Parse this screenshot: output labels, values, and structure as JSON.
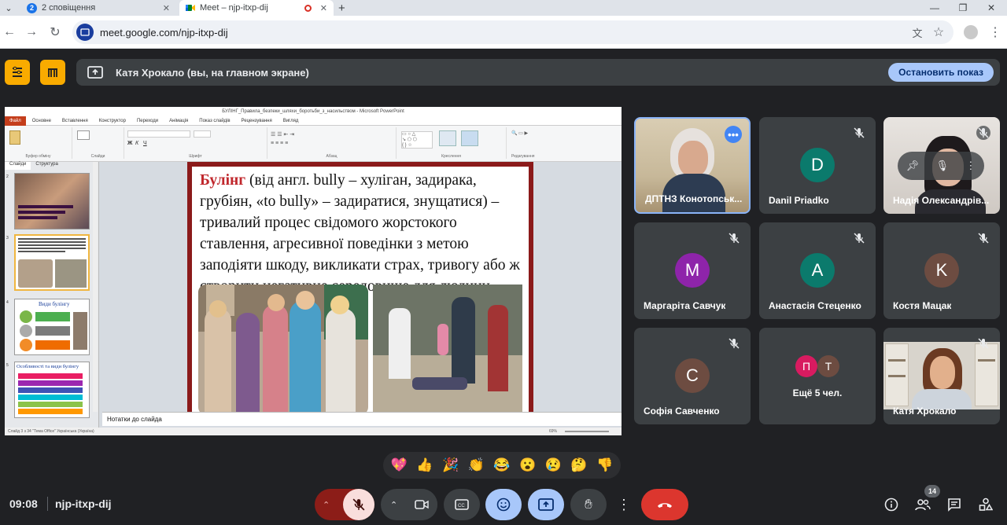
{
  "browser": {
    "tabs": [
      {
        "badge": "2",
        "label": "2 сповіщення"
      },
      {
        "label": "Meet – njp-itxp-dij"
      }
    ],
    "url": "meet.google.com/njp-itxp-dij"
  },
  "meet_top": {
    "presenting_text": "Катя Хрокало (вы, на главном экране)",
    "stop_label": "Остановить показ"
  },
  "powerpoint": {
    "title": "БУЛІНГ_Правила_безпеки_шляхи_боротьби_з_насильством - Microsoft PowerPoint",
    "file_tab": "Файл",
    "menu": [
      "Основне",
      "Вставлення",
      "Конструктор",
      "Переходи",
      "Анімація",
      "Показ слайдів",
      "Рецензування",
      "Вигляд"
    ],
    "ribbon_groups": [
      "Буфер обміну",
      "Слайди",
      "Шрифт",
      "Абзац",
      "Креслення",
      "Редагування"
    ],
    "thumb_tabs": [
      "Слайди",
      "Структура"
    ],
    "thumbnails": [
      {
        "num": "2"
      },
      {
        "num": "3"
      },
      {
        "num": "4",
        "title": "Види булінгу"
      },
      {
        "num": "5",
        "title": "Особливості та види булінгу"
      }
    ],
    "slide": {
      "keyword": "Булінг",
      "body": " (від англ. bully – хуліган, задирака, грубіян, «to bully» – задиратися, знущатися) – тривалий процес свідомого жорстокого ставлення, агресивної поведінки з метою заподіяти шкоду, викликати страх, тривогу або ж створити негативне середовище для людини."
    },
    "notes": "Нотатки до слайда",
    "status": "Слайд 3 з 34   \"Тема Office\"   Українська (Україна)",
    "zoom": "69%"
  },
  "participants": [
    {
      "name": "ДПТНЗ Конотопськ...",
      "type": "video",
      "speaking": true
    },
    {
      "name": "Danil Priadko",
      "initial": "D",
      "color": "#0b7a6c",
      "muted": true
    },
    {
      "name": "Надія Олександрів...",
      "type": "video",
      "muted": true
    },
    {
      "name": "Маргаріта Савчук",
      "initial": "M",
      "color": "#8e24aa",
      "muted": true
    },
    {
      "name": "Анастасія Стеценко",
      "initial": "A",
      "color": "#0b7a6c",
      "muted": true
    },
    {
      "name": "Костя Мацак",
      "initial": "K",
      "color": "#6d4c41",
      "muted": true
    },
    {
      "name": "Софія Савченко",
      "initial": "C",
      "color": "#6d4c41",
      "muted": true
    },
    {
      "name": "Ещё 5 чел.",
      "initials": [
        "П",
        "Т"
      ],
      "colors": [
        "#d81b60",
        "#6d4c41"
      ]
    },
    {
      "name": "Катя Хрокало",
      "type": "video",
      "muted": true
    }
  ],
  "reactions": [
    "💖",
    "👍",
    "🎉",
    "👏",
    "😂",
    "😮",
    "😢",
    "🤔",
    "👎"
  ],
  "bottom": {
    "time": "09:08",
    "meeting_code": "njp-itxp-dij",
    "participant_count": "14"
  },
  "colors": {
    "accent": "#8ab4f8",
    "end_call": "#ea4335",
    "stop_button": "#a8c7fa",
    "host_controls": "#f9ab00"
  }
}
